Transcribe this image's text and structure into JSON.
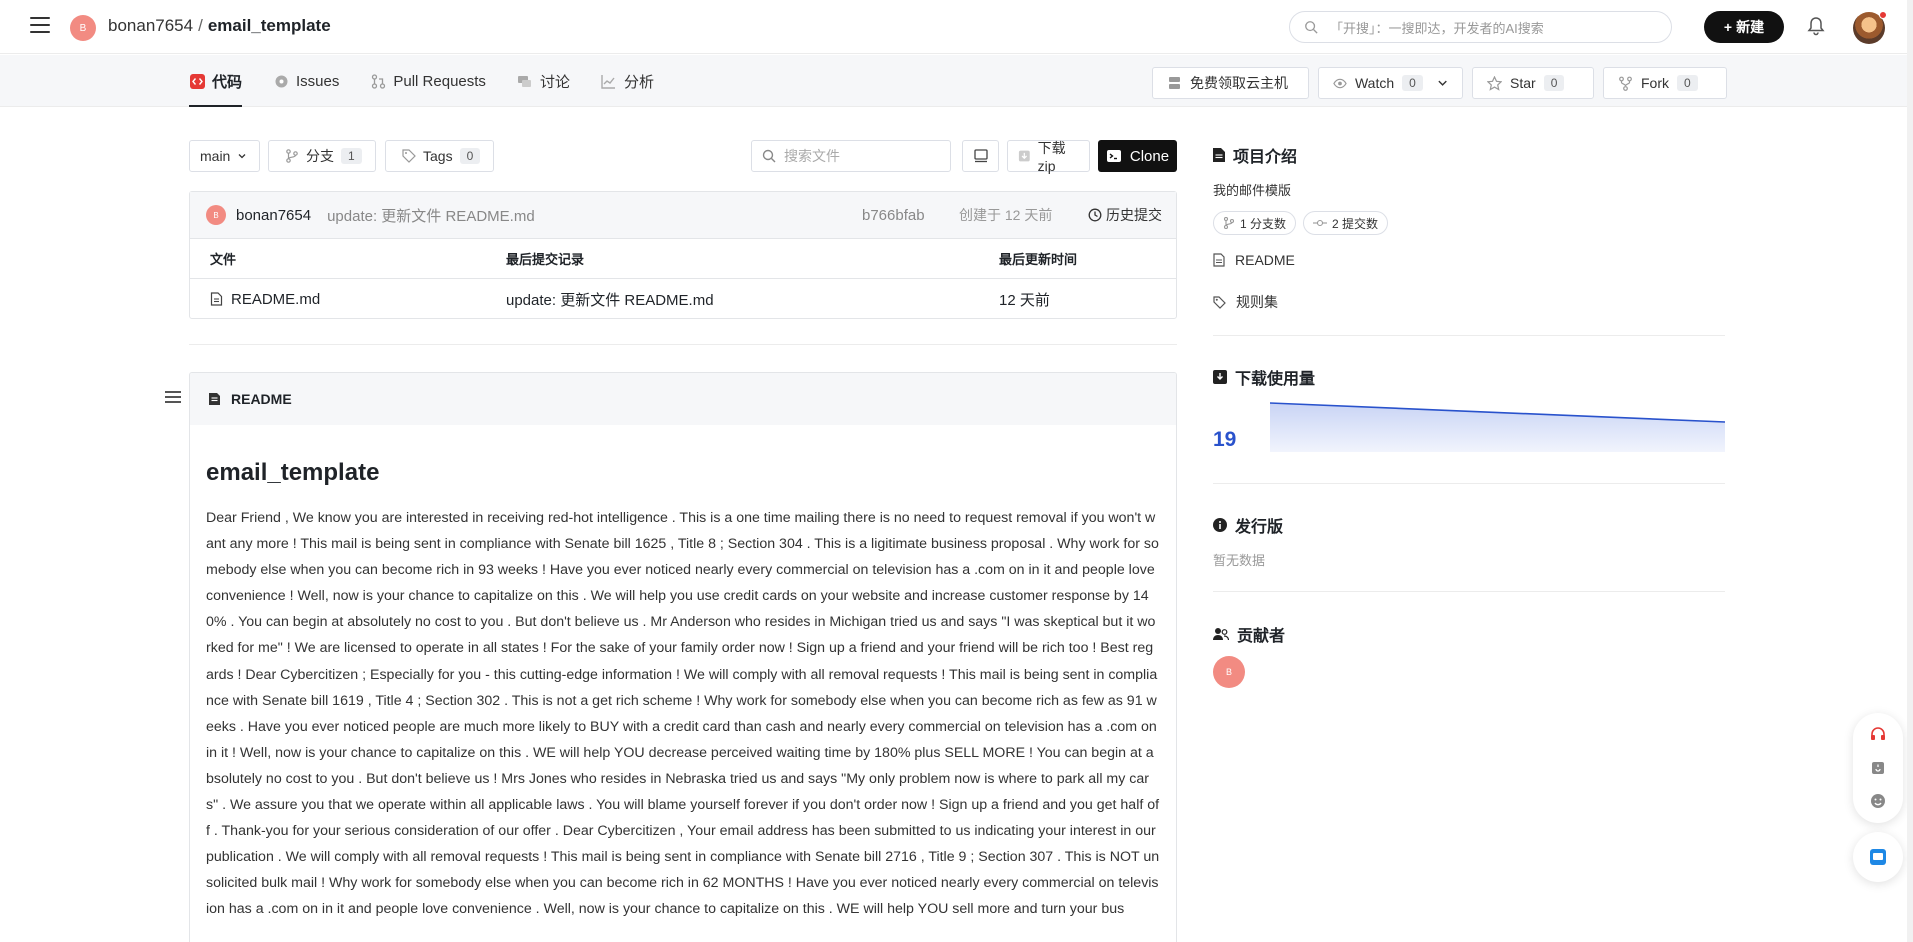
{
  "header": {
    "repo_avatar_letter": "B",
    "owner": "bonan7654",
    "separator": "/",
    "repo_name": "email_template",
    "search_placeholder": "「开搜」：一搜即达，开发者的AI搜索",
    "new_button": "新建"
  },
  "tabs": [
    {
      "label": "代码",
      "icon": "code-icon",
      "active": true
    },
    {
      "label": "Issues",
      "icon": "issues-icon"
    },
    {
      "label": "Pull Requests",
      "icon": "pull-request-icon"
    },
    {
      "label": "讨论",
      "icon": "discussion-icon"
    },
    {
      "label": "分析",
      "icon": "analytics-icon"
    }
  ],
  "repo_actions": {
    "cloud": "免费领取云主机",
    "watch": "Watch",
    "watch_count": "0",
    "star": "Star",
    "star_count": "0",
    "fork": "Fork",
    "fork_count": "0"
  },
  "branchbar": {
    "branch": "main",
    "branches_label": "分支",
    "branches_count": "1",
    "tags_label": "Tags",
    "tags_count": "0",
    "file_search_placeholder": "搜索文件",
    "download": "下载zip",
    "clone": "Clone"
  },
  "commit": {
    "avatar_letter": "B",
    "author": "bonan7654",
    "message": "update: 更新文件 README.md",
    "hash": "b766bfab",
    "created": "创建于 12 天前",
    "history": "历史提交"
  },
  "files": {
    "headers": [
      "文件",
      "最后提交记录",
      "最后更新时间"
    ],
    "rows": [
      {
        "name": "README.md",
        "commit": "update: 更新文件 README.md",
        "time": "12 天前"
      }
    ]
  },
  "readme": {
    "label": "README",
    "title": "email_template",
    "body": "Dear Friend , We know you are interested in receiving red-hot intelligence . This is a one time mailing there is no need to request removal if you won't want any more ! This mail is being sent in compliance with Senate bill 1625 , Title 8 ; Section 304 . This is a ligitimate business proposal . Why work for somebody else when you can become rich in 93 weeks ! Have you ever noticed nearly every commercial on television has a .com on in it and people love convenience ! Well, now is your chance to capitalize on this . We will help you use credit cards on your website and increase customer response by 140% . You can begin at absolutely no cost to you . But don't believe us . Mr Anderson who resides in Michigan tried us and says \"I was skeptical but it worked for me\" ! We are licensed to operate in all states ! For the sake of your family order now ! Sign up a friend and your friend will be rich too ! Best regards ! Dear Cybercitizen ; Especially for you - this cutting-edge information ! We will comply with all removal requests ! This mail is being sent in compliance with Senate bill 1619 , Title 4 ; Section 302 . This is not a get rich scheme ! Why work for somebody else when you can become rich as few as 91 weeks . Have you ever noticed people are much more likely to BUY with a credit card than cash and nearly every commercial on television has a .com on in it ! Well, now is your chance to capitalize on this . WE will help YOU decrease perceived waiting time by 180% plus SELL MORE ! You can begin at absolutely no cost to you . But don't believe us ! Mrs Jones who resides in Nebraska tried us and says \"My only problem now is where to park all my cars\" . We assure you that we operate within all applicable laws . You will blame yourself forever if you don't order now ! Sign up a friend and you get half off . Thank-you for your serious consideration of our offer . Dear Cybercitizen , Your email address has been submitted to us indicating your interest in our publication . We will comply with all removal requests ! This mail is being sent in compliance with Senate bill 2716 , Title 9 ; Section 307 . This is NOT unsolicited bulk mail ! Why work for somebody else when you can become rich in 62 MONTHS ! Have you ever noticed nearly every commercial on television has a .com on in it and people love convenience . Well, now is your chance to capitalize on this . WE will help YOU sell more and turn your bus"
  },
  "sidebar": {
    "intro_title": "项目介绍",
    "description": "我的邮件模版",
    "branches_pill": "1 分支数",
    "commits_pill": "2 提交数",
    "readme_link": "README",
    "rules_link": "规则集",
    "downloads_title": "下载使用量",
    "downloads_count": "19",
    "downloads_trend": [
      19,
      15
    ],
    "releases_title": "发行版",
    "releases_empty": "暂无数据",
    "contributors_title": "贡献者",
    "contributor_letter": "B"
  },
  "colors": {
    "accent_blue": "#2952cc",
    "avatar": "#f28b82",
    "code_tab": "#e53935"
  }
}
